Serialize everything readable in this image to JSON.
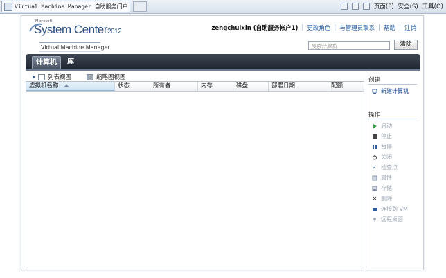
{
  "browser": {
    "tab_title": "Virtual Machine Manager 自助服务门户",
    "commands": [
      "页面(P)",
      "安全(S)",
      "工具(O)"
    ]
  },
  "header": {
    "brand_small": "Microsoft",
    "brand_name": "System Center",
    "brand_year": "2012",
    "product": "Virtual Machine Manager",
    "user": "zengchuixin (自助服务帐户1)",
    "links": [
      "更改角色",
      "与管理员联系",
      "帮助",
      "注销"
    ],
    "search": {
      "placeholder": "搜索计算机",
      "button": "清除"
    }
  },
  "nav": {
    "tabs": [
      "计算机",
      "库"
    ],
    "active": "计算机"
  },
  "view_switch": {
    "list": "列表视图",
    "thumb": "缩略图视图"
  },
  "grid": {
    "columns": [
      "虚拟机名称",
      "状态",
      "所有者",
      "内存",
      "磁盘",
      "部署日期",
      "配额"
    ],
    "rows": []
  },
  "sidepanel": {
    "create_title": "创建",
    "create_item": "新建计算机",
    "actions_title": "操作",
    "actions": [
      {
        "icon": "play-icon",
        "label": "启动"
      },
      {
        "icon": "stop-icon",
        "label": "停止"
      },
      {
        "icon": "pause-icon",
        "label": "暂停"
      },
      {
        "icon": "power-icon",
        "label": "关闭"
      },
      {
        "icon": "checkmark-icon",
        "label": "检查点"
      },
      {
        "icon": "properties-icon",
        "label": "属性"
      },
      {
        "icon": "save-icon",
        "label": "存储"
      },
      {
        "icon": "delete-icon",
        "label": "删除"
      },
      {
        "icon": "connect-icon",
        "label": "连接到 VM"
      },
      {
        "icon": "remote-desktop-icon",
        "label": "远程桌面"
      }
    ]
  },
  "colors": {
    "nav_dark": "#1f252f",
    "link": "#1f5aa6",
    "disabled": "#9aa4b1"
  }
}
